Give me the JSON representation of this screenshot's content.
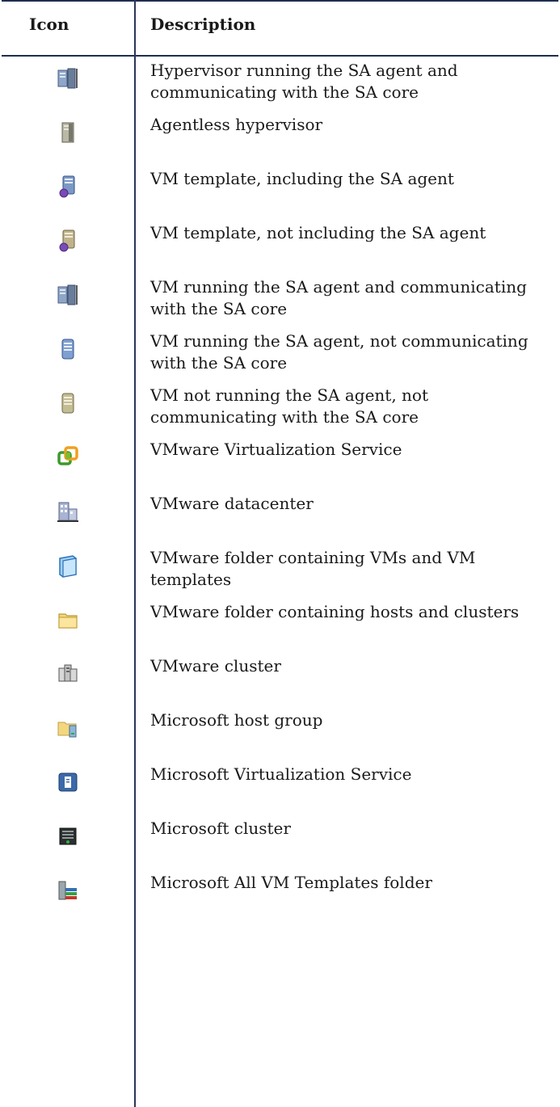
{
  "header": {
    "icon": "Icon",
    "description": "Description"
  },
  "rows": [
    {
      "icon": "hypervisor-agent-icon",
      "description": "Hypervisor running the SA agent and communicating with the SA core"
    },
    {
      "icon": "agentless-hypervisor-icon",
      "description": "Agentless hypervisor"
    },
    {
      "icon": "vm-template-agent-icon",
      "description": "VM template, including the SA agent"
    },
    {
      "icon": "vm-template-no-agent-icon",
      "description": "VM template, not including the SA agent"
    },
    {
      "icon": "vm-agent-communicating-icon",
      "description": "VM running the SA agent and communicating with the SA core"
    },
    {
      "icon": "vm-agent-not-communicating-icon",
      "description": "VM running the SA agent, not communicating with the SA core"
    },
    {
      "icon": "vm-no-agent-icon",
      "description": "VM not running the SA agent, not communicating with the SA core"
    },
    {
      "icon": "vmware-virtualization-service-icon",
      "description": "VMware Virtualization Service"
    },
    {
      "icon": "vmware-datacenter-icon",
      "description": "VMware datacenter"
    },
    {
      "icon": "vmware-vm-folder-icon",
      "description": "VMware folder containing VMs and VM templates"
    },
    {
      "icon": "vmware-host-folder-icon",
      "description": "VMware folder containing hosts and clusters"
    },
    {
      "icon": "vmware-cluster-icon",
      "description": "VMware cluster"
    },
    {
      "icon": "microsoft-host-group-icon",
      "description": "Microsoft host group"
    },
    {
      "icon": "microsoft-virtualization-service-icon",
      "description": "Microsoft Virtualization Service"
    },
    {
      "icon": "microsoft-cluster-icon",
      "description": "Microsoft cluster"
    },
    {
      "icon": "microsoft-vm-templates-folder-icon",
      "description": "Microsoft All VM Templates folder"
    }
  ]
}
